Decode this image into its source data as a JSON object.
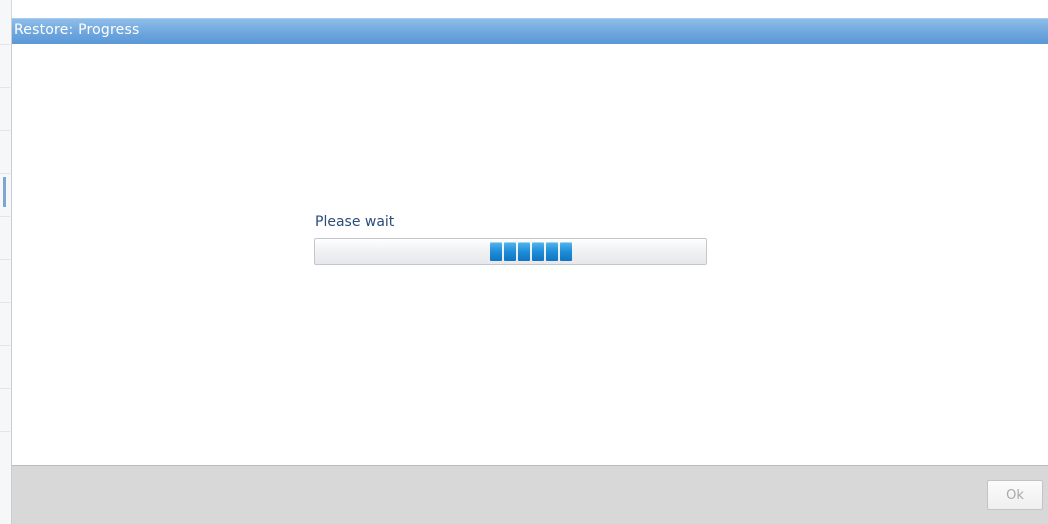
{
  "dialog": {
    "title": "Restore: Progress",
    "title_bar_color": "#6ea6dd",
    "status_label": "Please wait",
    "progress": {
      "mode": "indeterminate",
      "block_count": 6,
      "block_color": "#1f8ed8"
    },
    "footer": {
      "ok_label": "Ok",
      "ok_enabled": false
    }
  }
}
